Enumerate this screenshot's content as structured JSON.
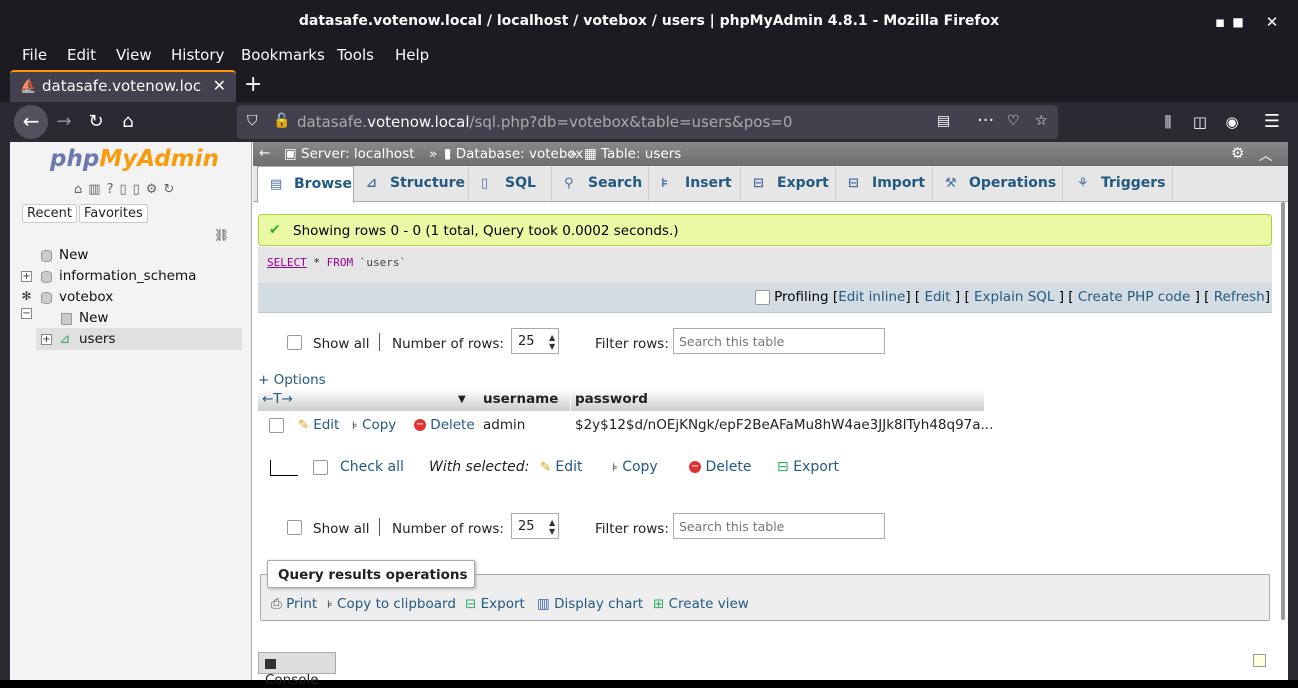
{
  "window": {
    "title": "datasafe.votenow.local / localhost / votebox / users | phpMyAdmin 4.8.1 - Mozilla Firefox",
    "minimize": "▪",
    "maximize": "■",
    "close": "✕"
  },
  "menubar": [
    "File",
    "Edit",
    "View",
    "History",
    "Bookmarks",
    "Tools",
    "Help"
  ],
  "tab": {
    "label": "datasafe.votenow.local / localhost",
    "close": "✕"
  },
  "newtab": "+",
  "url": {
    "domain_prefix": "datasafe.",
    "domain": "votenow.local",
    "path": "/sql.php?db=votebox&table=users&pos=0"
  },
  "sidebar": {
    "logo_php": "php",
    "logo_myadmin": "MyAdmin",
    "tabs": {
      "recent": "Recent",
      "favorites": "Favorites"
    },
    "tree": {
      "new_root": "New",
      "information_schema": "information_schema",
      "votebox": "votebox",
      "new_table": "New",
      "users": "users"
    }
  },
  "breadcrumb": {
    "server": "Server: localhost",
    "database": "Database: votebox",
    "table": "Table: users",
    "sep": "»"
  },
  "tabs": [
    "Browse",
    "Structure",
    "SQL",
    "Search",
    "Insert",
    "Export",
    "Import",
    "Operations",
    "Triggers"
  ],
  "success_message": "Showing rows 0 - 0 (1 total, Query took 0.0002 seconds.)",
  "sql": {
    "select": "SELECT",
    "star": "*",
    "from": "FROM",
    "table": "`users`"
  },
  "profiling": {
    "label": "Profiling",
    "links": [
      "Edit inline",
      "Edit",
      "Explain SQL",
      "Create PHP code",
      "Refresh"
    ]
  },
  "nav": {
    "show_all": "Show all",
    "number_of_rows_label": "Number of rows:",
    "number_of_rows": "25",
    "filter_label": "Filter rows:",
    "filter_placeholder": "Search this table"
  },
  "options": "+ Options",
  "table": {
    "columns": [
      "username",
      "password"
    ],
    "col_arrows": "←T→",
    "rows": [
      {
        "edit": "Edit",
        "copy": "Copy",
        "delete": "Delete",
        "username": "admin",
        "password": "$2y$12$d/nOEjKNgk/epF2BeAFaMu8hW4ae3JJk8ITyh48q97a..."
      }
    ]
  },
  "with_selected": {
    "check_all": "Check all",
    "label": "With selected:",
    "edit": "Edit",
    "copy": "Copy",
    "delete": "Delete",
    "export": "Export"
  },
  "query_results_ops": {
    "legend": "Query results operations",
    "print": "Print",
    "copy": "Copy to clipboard",
    "export": "Export",
    "display_chart": "Display chart",
    "create_view": "Create view"
  },
  "console": "Console",
  "colors": {
    "accent": "#ff9400",
    "link": "#235a81",
    "success_bg": "#ebf8a4"
  }
}
